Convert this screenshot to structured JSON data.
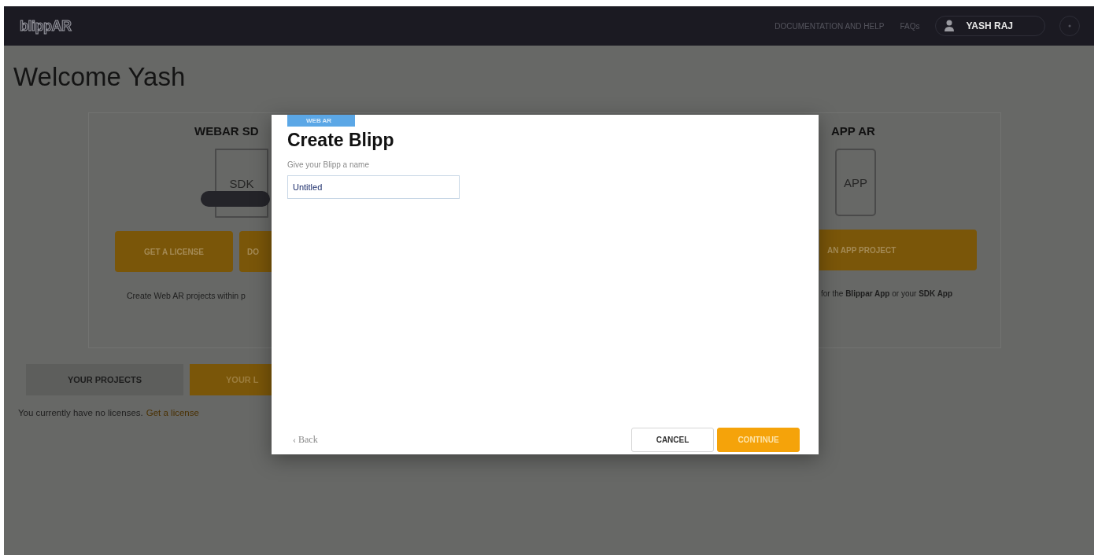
{
  "header": {
    "logo": "blippAR",
    "links": [
      "DOCUMENTATION AND HELP",
      "FAQs"
    ],
    "user": "YASH RAJ"
  },
  "welcome": "Welcome Yash",
  "cards": [
    {
      "kind": "sdk",
      "title": "WEBAR SD",
      "icon_label": "SDK",
      "buttons": [
        "GET A LICENSE",
        "DO"
      ],
      "description": "Create Web AR projects within p"
    },
    {
      "kind": "app",
      "title": "APP AR",
      "icon_label": "APP",
      "buttons": [
        "AN APP PROJECT"
      ],
      "description": "for the **Blippar App** or your **SDK App**"
    }
  ],
  "tabs": [
    {
      "label": "YOUR PROJECTS",
      "selected": false
    },
    {
      "label": "YOUR L",
      "selected": true
    }
  ],
  "message": {
    "text": "You currently have no licenses.",
    "link": "Get a license"
  },
  "dialog": {
    "tag": "WEB AR",
    "title": "Create Blipp",
    "field_label": "Give your Blipp a name",
    "field_value": "Untitled",
    "back": "‹ Back",
    "buttons": [
      {
        "label": "CANCEL",
        "kind": "secondary"
      },
      {
        "label": "CONTINUE",
        "kind": "primary"
      }
    ]
  }
}
